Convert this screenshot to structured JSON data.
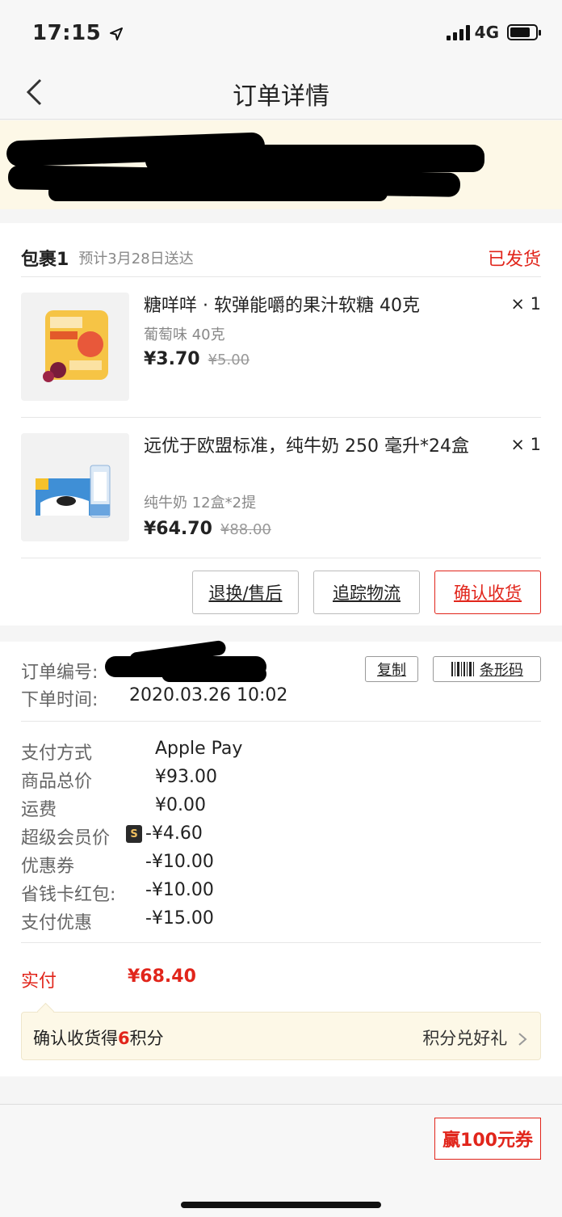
{
  "status_bar": {
    "time": "17:15",
    "network": "4G"
  },
  "nav": {
    "title": "订单详情"
  },
  "package": {
    "name": "包裹1",
    "eta": "预计3月28日送达",
    "status": "已发货",
    "items": [
      {
        "title": "糖咩咩 · 软弹能嚼的果汁软糖 40克",
        "spec": "葡萄味 40克",
        "price": "¥3.70",
        "original_price": "¥5.00",
        "qty": "× 1"
      },
      {
        "title": "远优于欧盟标准，纯牛奶 250 毫升*24盒",
        "spec": "纯牛奶 12盒*2提",
        "price": "¥64.70",
        "original_price": "¥88.00",
        "qty": "× 1"
      }
    ],
    "actions": {
      "return": "退换/售后",
      "track": "追踪物流",
      "confirm": "确认收货"
    }
  },
  "order": {
    "number_label": "订单编号:",
    "time_label": "下单时间:",
    "time_value": "2020.03.26 10:02",
    "copy_label": "复制",
    "barcode_label": "条形码"
  },
  "payment": {
    "method_label": "支付方式",
    "method_value": "Apple Pay",
    "total_label": "商品总价",
    "total_value": "¥93.00",
    "shipping_label": "运费",
    "shipping_value": "¥0.00",
    "svip_label": "超级会员价",
    "svip_value": "-¥4.60",
    "coupon_label": "优惠券",
    "coupon_value": "-¥10.00",
    "card_label": "省钱卡红包:",
    "card_value": "-¥10.00",
    "pay_discount_label": "支付优惠",
    "pay_discount_value": "-¥15.00",
    "actual_label": "实付",
    "actual_value": "¥68.40"
  },
  "points": {
    "prefix": "确认收货得",
    "count": "6",
    "suffix": "积分",
    "link": "积分兑好礼"
  },
  "bottom": {
    "coupon": "赢100元券"
  }
}
